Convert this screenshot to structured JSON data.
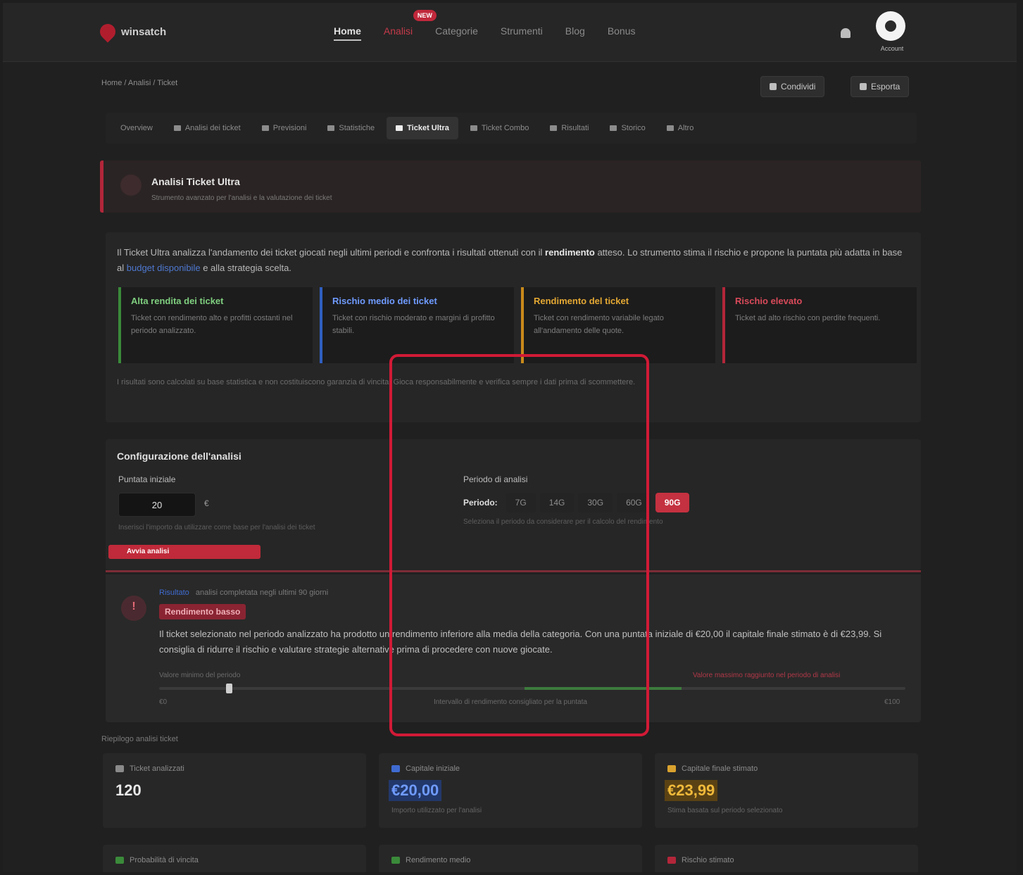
{
  "app": {
    "name": "winsatch"
  },
  "nav": [
    {
      "label": "Home",
      "state": "active"
    },
    {
      "label": "Analisi",
      "state": "hot",
      "badge": "NEW"
    },
    {
      "label": "Categorie"
    },
    {
      "label": "Strumenti"
    },
    {
      "label": "Blog"
    },
    {
      "label": "Bonus"
    }
  ],
  "user": {
    "name": "Account"
  },
  "breadcrumb": "Home / Analisi / Ticket",
  "toolbar": {
    "btn1": "Condividi",
    "btn2": "Esporta"
  },
  "tabs": [
    {
      "label": "Overview"
    },
    {
      "label": "Analisi dei ticket"
    },
    {
      "label": "Previsioni"
    },
    {
      "label": "Statistiche"
    },
    {
      "label": "Ticket Ultra",
      "active": true
    },
    {
      "label": "Ticket Combo"
    },
    {
      "label": "Risultati"
    },
    {
      "label": "Storico"
    },
    {
      "label": "Altro"
    }
  ],
  "alert": {
    "title": "Analisi Ticket Ultra",
    "subtitle": "Strumento avanzato per l'analisi e la valutazione dei ticket"
  },
  "info": {
    "text_before": "Il Ticket Ultra analizza l'andamento dei ticket giocati negli ultimi periodi e confronta i risultati ottenuti con il",
    "highlight": "rendimento",
    "text_middle": "atteso. Lo strumento stima il rischio e propone la puntata più adatta in base al",
    "link": "budget disponibile",
    "text_after": "e alla strategia scelta.",
    "cards": [
      {
        "title": "Alta rendita dei ticket",
        "desc": "Ticket con rendimento alto e profitti costanti nel periodo analizzato.",
        "color": "#3a8a3a",
        "title_color": "#7fcf7f"
      },
      {
        "title": "Rischio medio dei ticket",
        "desc": "Ticket con rischio moderato e margini di profitto stabili.",
        "color": "#2f5fc0",
        "title_color": "#6f9bff"
      },
      {
        "title": "Rendimento del ticket",
        "desc": "Ticket con rendimento variabile legato all'andamento delle quote.",
        "color": "#c98a1a",
        "title_color": "#e4a833"
      },
      {
        "title": "Rischio elevato",
        "desc": "Ticket ad alto rischio con perdite frequenti.",
        "color": "#b3263a",
        "title_color": "#d94a5a"
      }
    ],
    "note": "I risultati sono calcolati su base statistica e non costituiscono garanzia di vincita. Gioca responsabilmente e verifica sempre i dati prima di scommettere."
  },
  "config": {
    "title": "Configurazione dell'analisi",
    "amount_label": "Puntata iniziale",
    "amount_value": "20",
    "amount_unit": "€",
    "amount_hint": "Inserisci l'importo da utilizzare come base per l'analisi dei ticket",
    "period_section": "Periodo di analisi",
    "period_label": "Periodo:",
    "periods": [
      "7G",
      "14G",
      "30G",
      "60G",
      "90G"
    ],
    "active_period": "90G",
    "period_hint": "Seleziona il periodo da considerare per il calcolo del rendimento",
    "analyze_label": "Avvia analisi"
  },
  "result": {
    "link": "Risultato",
    "meta": "analisi completata negli ultimi 90 giorni",
    "badge": "Rendimento basso",
    "text": "Il ticket selezionato nel periodo analizzato ha prodotto un rendimento inferiore alla media della categoria. Con una puntata iniziale di €20,00 il capitale finale stimato è di €23,99. Si consiglia di ridurre il rischio e valutare strategie alternative prima di procedere con nuove giocate.",
    "left_label": "Valore minimo del periodo",
    "right_label": "Valore massimo raggiunto nel periodo di analisi",
    "mid_label": "Intervallo di rendimento consigliato per la puntata",
    "min": "€0",
    "max": "€100",
    "green_start": 0.49,
    "green_end": 0.7,
    "knob_position": 0.09
  },
  "summary": {
    "label": "Riepilogo analisi ticket"
  },
  "stats": [
    {
      "label": "Ticket analizzati",
      "value": "120",
      "sub": "",
      "color": "#e8e8e8",
      "bg": "transparent",
      "icon_color": "#8a8a8a"
    },
    {
      "label": "Capitale iniziale",
      "value": "€20,00",
      "sub": "Importo utilizzato per l'analisi",
      "color": "#6f9bff",
      "bg": "#22386a",
      "icon_color": "#3f6bd0"
    },
    {
      "label": "Capitale finale stimato",
      "value": "€23,99",
      "sub": "Stima basata sul periodo selezionato",
      "color": "#f0b93a",
      "bg": "#5a4214",
      "icon_color": "#d9a22e"
    }
  ],
  "stats2": [
    {
      "label": "Probabilità di vincita",
      "icon_color": "#3a8a3a"
    },
    {
      "label": "Rendimento medio",
      "icon_color": "#3a8a3a"
    },
    {
      "label": "Rischio stimato",
      "icon_color": "#b3263a"
    }
  ]
}
